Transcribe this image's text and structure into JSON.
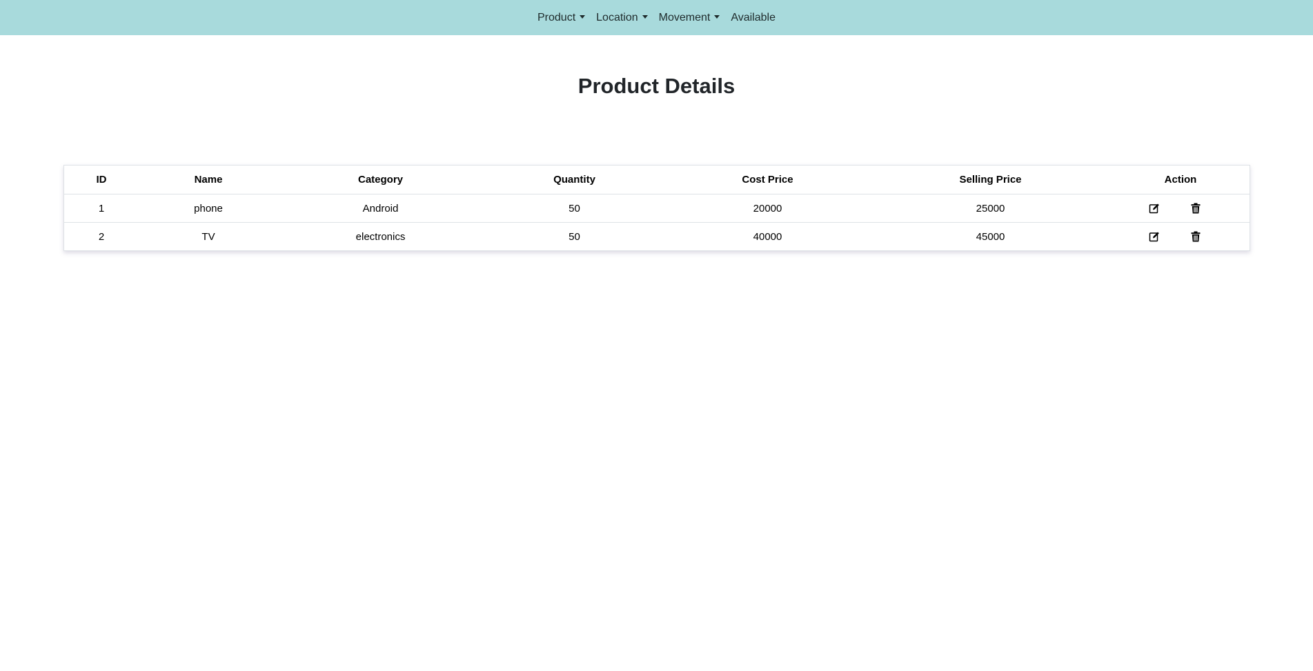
{
  "nav": {
    "items": [
      {
        "label": "Product",
        "dropdown": true
      },
      {
        "label": "Location",
        "dropdown": true
      },
      {
        "label": "Movement",
        "dropdown": true
      },
      {
        "label": "Available",
        "dropdown": false
      }
    ]
  },
  "page": {
    "title": "Product Details"
  },
  "table": {
    "headers": {
      "id": "ID",
      "name": "Name",
      "category": "Category",
      "quantity": "Quantity",
      "cost_price": "Cost Price",
      "selling_price": "Selling Price",
      "action": "Action"
    },
    "rows": [
      {
        "id": "1",
        "name": "phone",
        "category": "Android",
        "quantity": "50",
        "cost_price": "20000",
        "selling_price": "25000"
      },
      {
        "id": "2",
        "name": "TV",
        "category": "electronics",
        "quantity": "50",
        "cost_price": "40000",
        "selling_price": "45000"
      }
    ]
  },
  "colors": {
    "navbar_bg": "#a8dadc"
  },
  "icons": {
    "edit": "edit-icon",
    "delete": "trash-icon"
  }
}
